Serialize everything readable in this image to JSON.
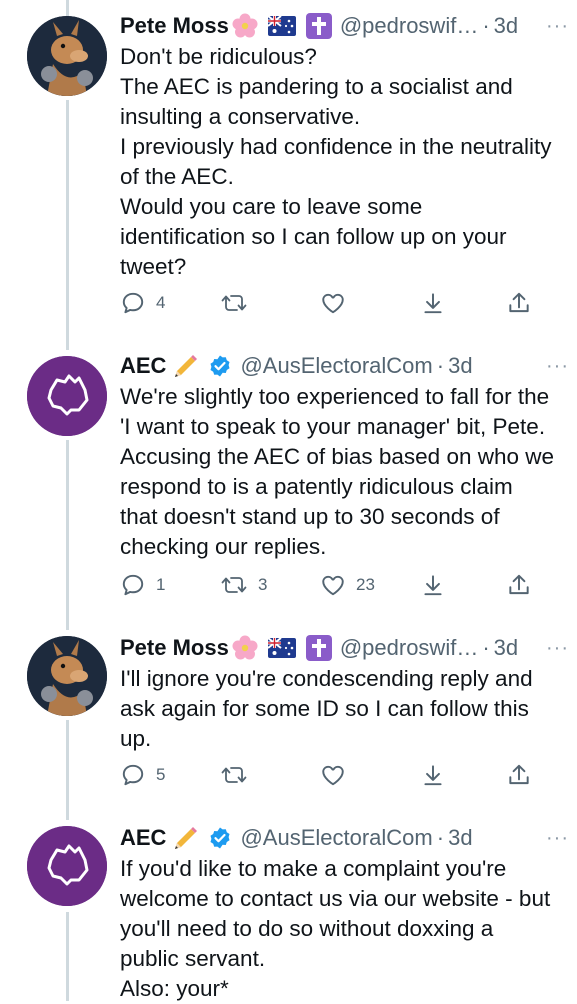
{
  "tweets": [
    {
      "name": "Pete Moss",
      "handle": "@pedroswif…",
      "time": "3d",
      "avatar": "kangaroo-avatar",
      "emojis": [
        "cherry-blossom-icon",
        "australia-flag-icon",
        "latin-cross-icon"
      ],
      "lines": [
        "Don't be ridiculous?",
        "The AEC is pandering to a socialist and",
        "insulting a conservative.",
        "I previously had confidence in the neutrality",
        "of the AEC.",
        "Would you care to leave some",
        "identification so I can follow up on your",
        "tweet?"
      ],
      "replies": "4",
      "retweets": "",
      "likes": ""
    },
    {
      "name": "AEC",
      "handle": "@AusElectoralCom",
      "time": "3d",
      "avatar": "aec-logo-avatar",
      "emojis": [
        "pencil-icon",
        "verified-badge-icon"
      ],
      "lines": [
        "We're slightly too experienced to fall for the",
        "'I want to speak to your manager' bit, Pete.",
        "Accusing the AEC of bias based on who we",
        "respond to is a patently ridiculous claim",
        "that doesn't stand up to 30 seconds of",
        "checking our replies."
      ],
      "replies": "1",
      "retweets": "3",
      "likes": "23"
    },
    {
      "name": "Pete Moss",
      "handle": "@pedroswif…",
      "time": "3d",
      "avatar": "kangaroo-avatar",
      "emojis": [
        "cherry-blossom-icon",
        "australia-flag-icon",
        "latin-cross-icon"
      ],
      "lines": [
        "I'll ignore you're condescending reply and",
        "ask again for some ID so I can follow this",
        "up."
      ],
      "replies": "5",
      "retweets": "",
      "likes": ""
    },
    {
      "name": "AEC",
      "handle": "@AusElectoralCom",
      "time": "3d",
      "avatar": "aec-logo-avatar",
      "emojis": [
        "pencil-icon",
        "verified-badge-icon"
      ],
      "lines": [
        "If you'd like to make a complaint you're",
        "welcome to contact us via our website - but",
        "you'll need to do so without doxxing a",
        "public servant.",
        "Also: your*"
      ],
      "replies": "",
      "retweets": "",
      "likes": ""
    }
  ],
  "separator": "·",
  "more_label": "···",
  "colors": {
    "aec_purple": "#6b2c86",
    "verified_blue": "#1d9bf0",
    "muted": "#536471",
    "thread_line": "#cfd9de"
  }
}
